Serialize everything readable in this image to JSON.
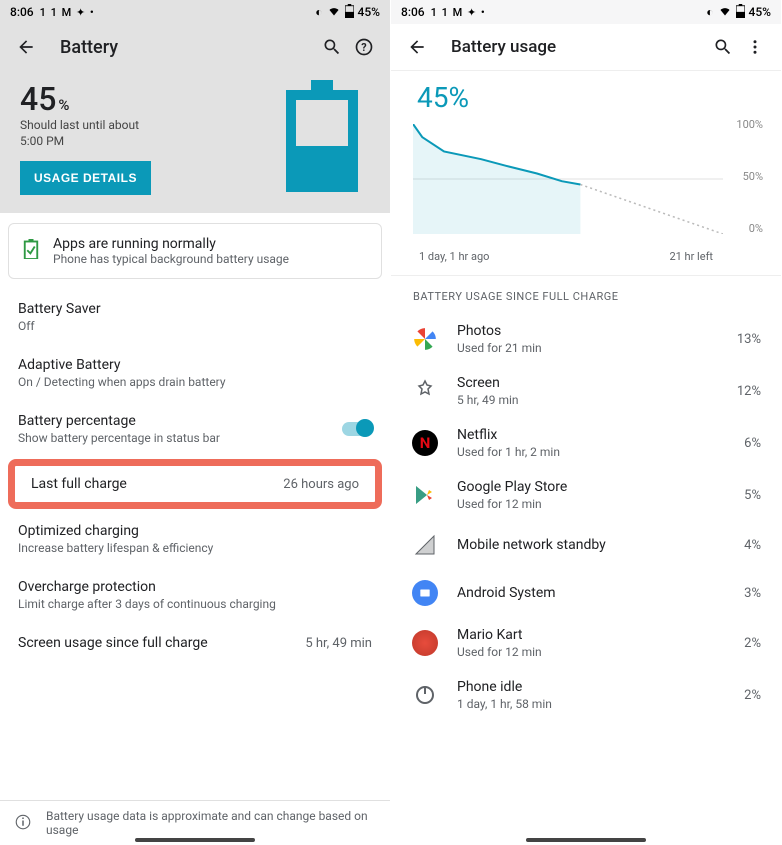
{
  "statusbar": {
    "time": "8:06",
    "pct": "45%",
    "icons": "1  1  M  ✦  •"
  },
  "left": {
    "title": "Battery",
    "hero_pct": "45",
    "hero_unit": "%",
    "est_line1": "Should last until about",
    "est_line2": "5:00 PM",
    "details_btn": "USAGE DETAILS",
    "card_title": "Apps are running normally",
    "card_sub": "Phone has typical background battery usage",
    "rows": [
      {
        "t1": "Battery Saver",
        "t2": "Off"
      },
      {
        "t1": "Adaptive Battery",
        "t2": "On / Detecting when apps drain battery"
      },
      {
        "t1": "Battery percentage",
        "t2": "Show battery percentage in status bar",
        "toggle": true
      },
      {
        "t1": "Last full charge",
        "val": "26 hours ago",
        "highlight": true
      },
      {
        "t1": "Optimized charging",
        "t2": "Increase battery lifespan & efficiency"
      },
      {
        "t1": "Overcharge protection",
        "t2": "Limit charge after 3 days of continuous charging"
      },
      {
        "t1": "Screen usage since full charge",
        "val": "5 hr, 49 min"
      }
    ],
    "footer": "Battery usage data is approximate and can change based on usage"
  },
  "right": {
    "title": "Battery usage",
    "chart_pct": "45%",
    "x_start": "1 day, 1 hr ago",
    "x_end": "21 hr left",
    "section": "BATTERY USAGE SINCE FULL CHARGE",
    "apps": [
      {
        "name": "Photos",
        "sub": "Used for 21 min",
        "pct": "13%",
        "icon": "photos"
      },
      {
        "name": "Screen",
        "sub": "5 hr, 49 min",
        "pct": "12%",
        "icon": "screen"
      },
      {
        "name": "Netflix",
        "sub": "Used for 1 hr, 2 min",
        "pct": "6%",
        "icon": "netflix"
      },
      {
        "name": "Google Play Store",
        "sub": "Used for 12 min",
        "pct": "5%",
        "icon": "play"
      },
      {
        "name": "Mobile network standby",
        "sub": "",
        "pct": "4%",
        "icon": "signal"
      },
      {
        "name": "Android System",
        "sub": "",
        "pct": "3%",
        "icon": "android"
      },
      {
        "name": "Mario Kart",
        "sub": "Used for 12 min",
        "pct": "2%",
        "icon": "mario"
      },
      {
        "name": "Phone idle",
        "sub": "1 day, 1 hr, 58 min",
        "pct": "2%",
        "icon": "power"
      }
    ]
  },
  "chart_data": {
    "type": "line",
    "title": "Battery usage",
    "ylabel": "",
    "xlabel": "",
    "ylim": [
      0,
      100
    ],
    "x_range_label": [
      "1 day, 1 hr ago",
      "21 hr left"
    ],
    "series": [
      {
        "name": "battery_pct_actual",
        "x_frac": [
          0,
          0.03,
          0.1,
          0.22,
          0.3,
          0.4,
          0.48,
          0.54
        ],
        "values": [
          100,
          88,
          75,
          68,
          62,
          55,
          48,
          45
        ]
      },
      {
        "name": "battery_pct_projected",
        "x_frac": [
          0.54,
          1.0
        ],
        "values": [
          45,
          0
        ],
        "style": "dotted"
      }
    ],
    "tick_labels_y": [
      "0%",
      "50%",
      "100%"
    ]
  }
}
